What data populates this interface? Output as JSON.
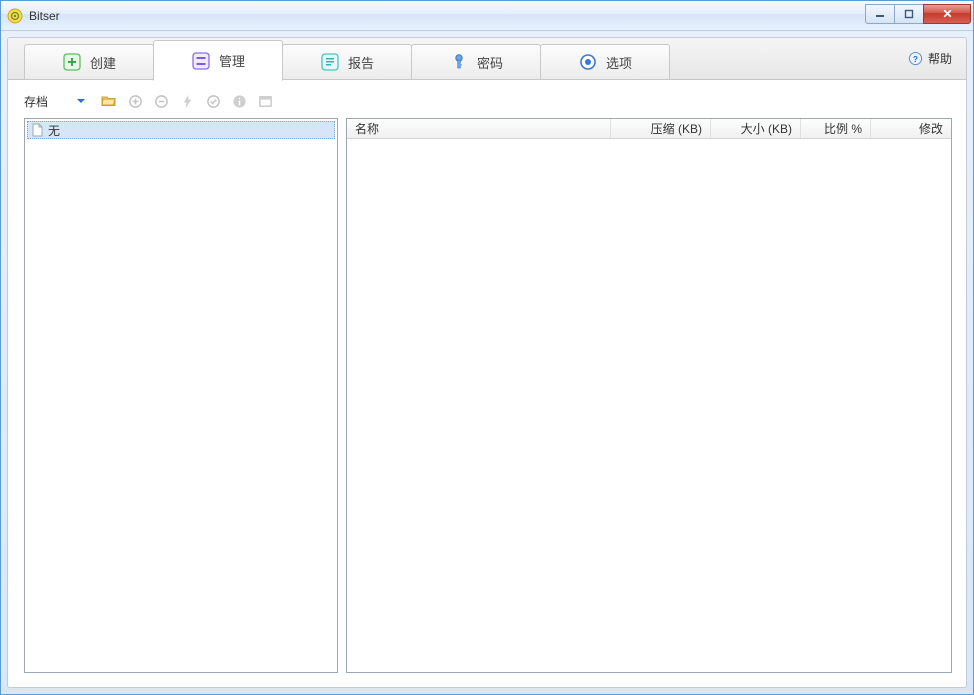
{
  "window": {
    "title": "Bitser"
  },
  "tabs": [
    {
      "id": "create",
      "label": "创建"
    },
    {
      "id": "manage",
      "label": "管理"
    },
    {
      "id": "report",
      "label": "报告"
    },
    {
      "id": "password",
      "label": "密码"
    },
    {
      "id": "options",
      "label": "选项"
    }
  ],
  "active_tab": "manage",
  "help": {
    "label": "帮助"
  },
  "toolbar": {
    "archive_label": "存档"
  },
  "tree": {
    "items": [
      {
        "label": "无"
      }
    ]
  },
  "list": {
    "columns": {
      "name": "名称",
      "compressed": "压缩 (KB)",
      "size": "大小 (KB)",
      "ratio": "比例 %",
      "modified": "修改"
    },
    "rows": []
  }
}
